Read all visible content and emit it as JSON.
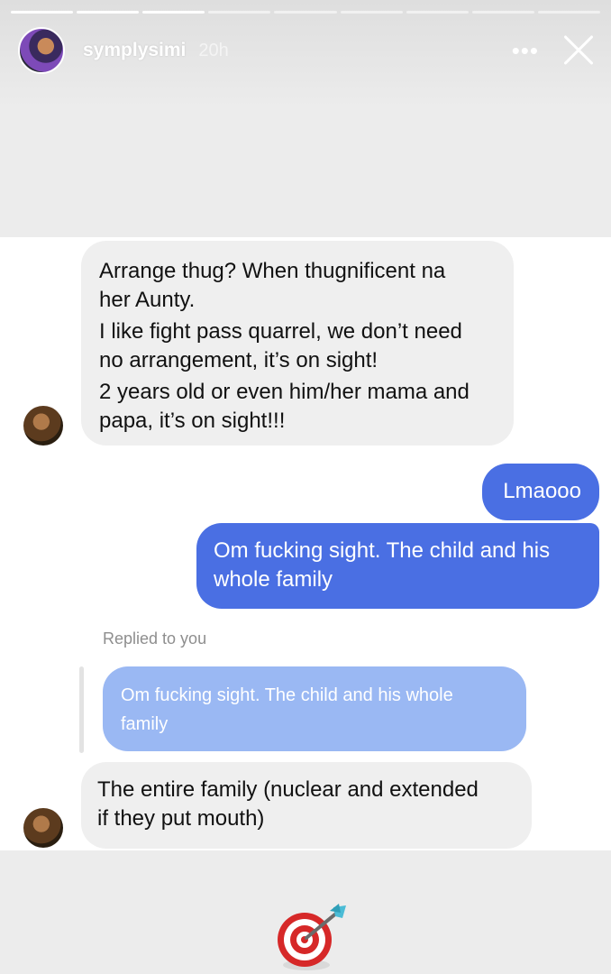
{
  "story": {
    "username": "symplysimi",
    "time": "20h",
    "more_label": "•••",
    "progress_total": 9,
    "progress_done": 3
  },
  "messages": [
    {
      "from": "them",
      "lines": [
        "Arrange thug? When thugnificent na",
        "her Aunty.",
        "I like fight pass quarrel, we don’t need",
        "no arrangement, it’s on sight!",
        "2 years old or even him/her mama and",
        "papa, it’s on sight!!!"
      ]
    },
    {
      "from": "me",
      "lines": [
        "Lmaooo"
      ]
    },
    {
      "from": "me",
      "lines": [
        "Om fucking sight. The child and his",
        "whole family"
      ]
    },
    {
      "from": "them",
      "lines": [
        "The entire family (nuclear and extended",
        "if they put mouth)"
      ]
    }
  ],
  "reply": {
    "label": "Replied to you",
    "quoted_lines": [
      "Om fucking sight. The child and his whole",
      "family"
    ]
  },
  "sticker_icon": "dart-target-icon",
  "colors": {
    "outgoing": "#4a6fe3",
    "incoming": "#efefef",
    "quote": "#9ab8f3"
  }
}
